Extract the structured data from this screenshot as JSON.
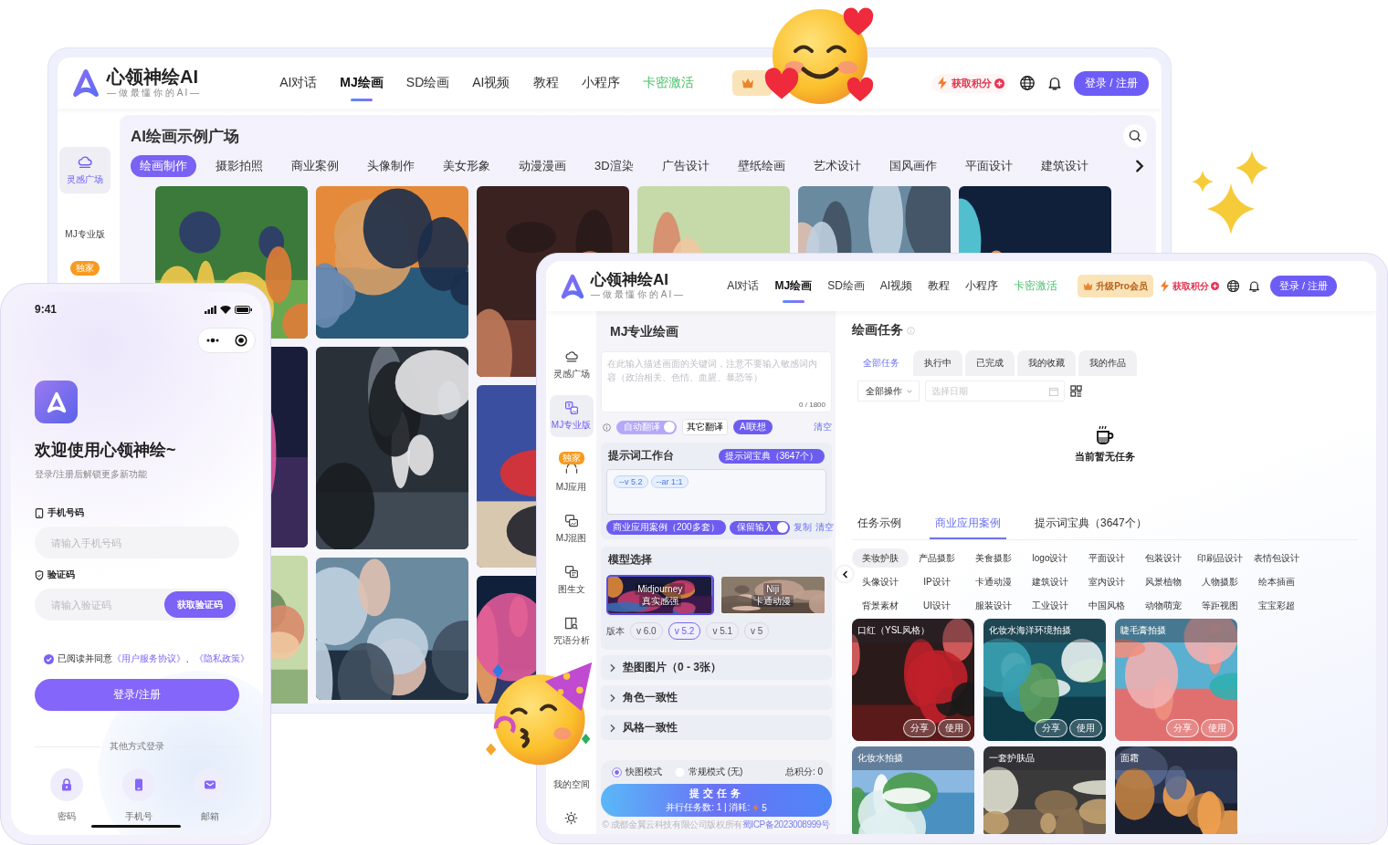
{
  "back_window": {
    "logo": {
      "name": "心领神绘AI",
      "slogan": "— 做 最 懂 你 的 A I —"
    },
    "nav": [
      {
        "label": "AI对话",
        "selected": false,
        "kind": "link"
      },
      {
        "label": "MJ绘画",
        "selected": true,
        "kind": "link"
      },
      {
        "label": "SD绘画",
        "selected": false,
        "kind": "link"
      },
      {
        "label": "AI视频",
        "selected": false,
        "kind": "link"
      },
      {
        "label": "教程",
        "selected": false,
        "kind": "link"
      },
      {
        "label": "小程序",
        "selected": false,
        "kind": "link"
      },
      {
        "label": "卡密激活",
        "selected": false,
        "kind": "promo"
      }
    ],
    "points": "获取积分",
    "login": "登录 / 注册",
    "sidebar": [
      {
        "label": "灵感广场",
        "selected": true
      },
      {
        "label": "MJ专业版",
        "selected": false
      }
    ],
    "sidebar_badge": "独家",
    "title": "AI绘画示例广场",
    "categories": [
      {
        "label": "绘画制作",
        "selected": true
      },
      {
        "label": "摄影拍照",
        "selected": false
      },
      {
        "label": "商业案例",
        "selected": false
      },
      {
        "label": "头像制作",
        "selected": false
      },
      {
        "label": "美女形象",
        "selected": false
      },
      {
        "label": "动漫漫画",
        "selected": false
      },
      {
        "label": "3D渲染",
        "selected": false
      },
      {
        "label": "广告设计",
        "selected": false
      },
      {
        "label": "壁纸绘画",
        "selected": false
      },
      {
        "label": "艺术设计",
        "selected": false
      },
      {
        "label": "国风画作",
        "selected": false
      },
      {
        "label": "平面设计",
        "selected": false
      },
      {
        "label": "建筑设计",
        "selected": false
      }
    ]
  },
  "phone": {
    "time": "9:41",
    "title": "欢迎使用心领神绘~",
    "subtitle": "登录/注册后解锁更多新功能",
    "fields": [
      {
        "kind": "phone",
        "label": "手机号码",
        "placeholder": "请输入手机号码"
      },
      {
        "kind": "code",
        "label": "验证码",
        "placeholder": "请输入验证码",
        "action": "获取验证码"
      }
    ],
    "agreement": {
      "checked": true,
      "text": "已阅读并同意",
      "link_1": "《用户服务协议》",
      "separator": "、",
      "link_2": "《隐私政策》"
    },
    "login_button": "登录/注册",
    "other_login": "其他方式登录",
    "methods": [
      {
        "label": "密码"
      },
      {
        "label": "手机号"
      },
      {
        "label": "邮箱"
      }
    ]
  },
  "front_window": {
    "logo": {
      "name": "心领神绘AI",
      "slogan": "— 做 最 懂 你 的 A I —"
    },
    "nav": [
      {
        "label": "AI对话",
        "selected": false,
        "kind": "link"
      },
      {
        "label": "MJ绘画",
        "selected": true,
        "kind": "link"
      },
      {
        "label": "SD绘画",
        "selected": false,
        "kind": "link"
      },
      {
        "label": "AI视频",
        "selected": false,
        "kind": "link"
      },
      {
        "label": "教程",
        "selected": false,
        "kind": "link"
      },
      {
        "label": "小程序",
        "selected": false,
        "kind": "link"
      },
      {
        "label": "卡密激活",
        "selected": false,
        "kind": "promo"
      }
    ],
    "upgrade": "升级Pro会员",
    "points": "获取积分",
    "login": "登录 / 注册",
    "sidebar": [
      {
        "label": "灵感广场",
        "selected": false
      },
      {
        "label": "MJ专业版",
        "selected": true
      },
      {
        "label": "MJ应用",
        "selected": false,
        "badge": "独家"
      },
      {
        "label": "MJ混图",
        "selected": false
      },
      {
        "label": "图生文",
        "selected": false
      },
      {
        "label": "咒语分析",
        "selected": false
      },
      {
        "label": "我的空间",
        "selected": false
      }
    ],
    "composer": {
      "title": "MJ专业绘画",
      "prompt_placeholder": "在此输入描述画面的关键词，注意不要输入敏感词内容（政治相关、色情、血腥、暴恐等）",
      "counter": "0 / 1800",
      "auto_translate": {
        "label": "自动翻译",
        "on": true
      },
      "other_translate": "其它翻译",
      "ai_assist": "AI联想",
      "clear": "清空"
    },
    "workbench": {
      "title": "提示词工作台",
      "library_button": "提示词宝典（3647个）",
      "tags": [
        "--v 5.2",
        "--ar 1:1"
      ],
      "cases_button": "商业应用案例（200多套）",
      "keep_input": {
        "label": "保留输入",
        "on": true
      },
      "copy": "复制",
      "clear": "清空"
    },
    "models": {
      "title": "模型选择",
      "options": [
        {
          "name": "Midjourney",
          "caption": "真实感强",
          "selected": true
        },
        {
          "name": "Niji",
          "caption": "卡通动漫",
          "selected": false
        }
      ],
      "version_label": "版本",
      "versions": [
        {
          "label": "v 6.0",
          "selected": false
        },
        {
          "label": "v 5.2",
          "selected": true
        },
        {
          "label": "v 5.1",
          "selected": false
        },
        {
          "label": "v 5",
          "selected": false
        }
      ]
    },
    "sections": [
      {
        "label": "垫图图片（0 - 3张）",
        "expanded": false
      },
      {
        "label": "角色一致性",
        "expanded": false
      },
      {
        "label": "风格一致性",
        "expanded": false
      }
    ],
    "submit": {
      "modes": [
        {
          "label": "快图模式",
          "selected": true
        },
        {
          "label": "常规模式 (无)",
          "selected": false
        }
      ],
      "total": "总积分: 0",
      "button": "提交任务",
      "detail": "并行任务数: 1 | 消耗:",
      "cost": "5"
    },
    "footer": {
      "copyright": "© 成都金翼云科技有限公司版权所有",
      "icp": "蜀ICP备2023008999号"
    },
    "tasks": {
      "title": "绘画任务",
      "tabs": [
        {
          "label": "全部任务",
          "selected": true
        },
        {
          "label": "执行中",
          "selected": false
        },
        {
          "label": "已完成",
          "selected": false
        },
        {
          "label": "我的收藏",
          "selected": false
        },
        {
          "label": "我的作品",
          "selected": false
        }
      ],
      "filter": "全部操作",
      "date_placeholder": "选择日期",
      "empty": "当前暂无任务"
    },
    "examples": {
      "tabs": [
        {
          "label": "任务示例",
          "selected": false
        },
        {
          "label": "商业应用案例",
          "selected": true
        },
        {
          "label": "提示词宝典（3647个）",
          "selected": false
        }
      ],
      "chips": [
        {
          "label": "美妆护肤",
          "selected": true
        },
        {
          "label": "产品摄影",
          "selected": false
        },
        {
          "label": "美食摄影",
          "selected": false
        },
        {
          "label": "logo设计",
          "selected": false
        },
        {
          "label": "平面设计",
          "selected": false
        },
        {
          "label": "包装设计",
          "selected": false
        },
        {
          "label": "印刷品设计",
          "selected": false
        },
        {
          "label": "表情包设计",
          "selected": false
        },
        {
          "label": "头像设计",
          "selected": false
        },
        {
          "label": "IP设计",
          "selected": false
        },
        {
          "label": "卡通动漫",
          "selected": false
        },
        {
          "label": "建筑设计",
          "selected": false
        },
        {
          "label": "室内设计",
          "selected": false
        },
        {
          "label": "风景植物",
          "selected": false
        },
        {
          "label": "人物摄影",
          "selected": false
        },
        {
          "label": "绘本插画",
          "selected": false
        },
        {
          "label": "背景素材",
          "selected": false
        },
        {
          "label": "UI设计",
          "selected": false
        },
        {
          "label": "服装设计",
          "selected": false
        },
        {
          "label": "工业设计",
          "selected": false
        },
        {
          "label": "中国风格",
          "selected": false
        },
        {
          "label": "动物萌宠",
          "selected": false
        },
        {
          "label": "等距视图",
          "selected": false
        },
        {
          "label": "宝宝彩超",
          "selected": false
        }
      ],
      "cards": [
        {
          "title": "口红（YSL风格）",
          "actions": [
            "分享",
            "使用"
          ]
        },
        {
          "title": "化妆水海洋环境拍摄",
          "actions": [
            "分享",
            "使用"
          ]
        },
        {
          "title": "睫毛膏拍摄",
          "actions": [
            "分享",
            "使用"
          ]
        },
        {
          "title": "化妆水拍摄"
        },
        {
          "title": "一套护肤品"
        },
        {
          "title": "面霜"
        }
      ]
    }
  }
}
